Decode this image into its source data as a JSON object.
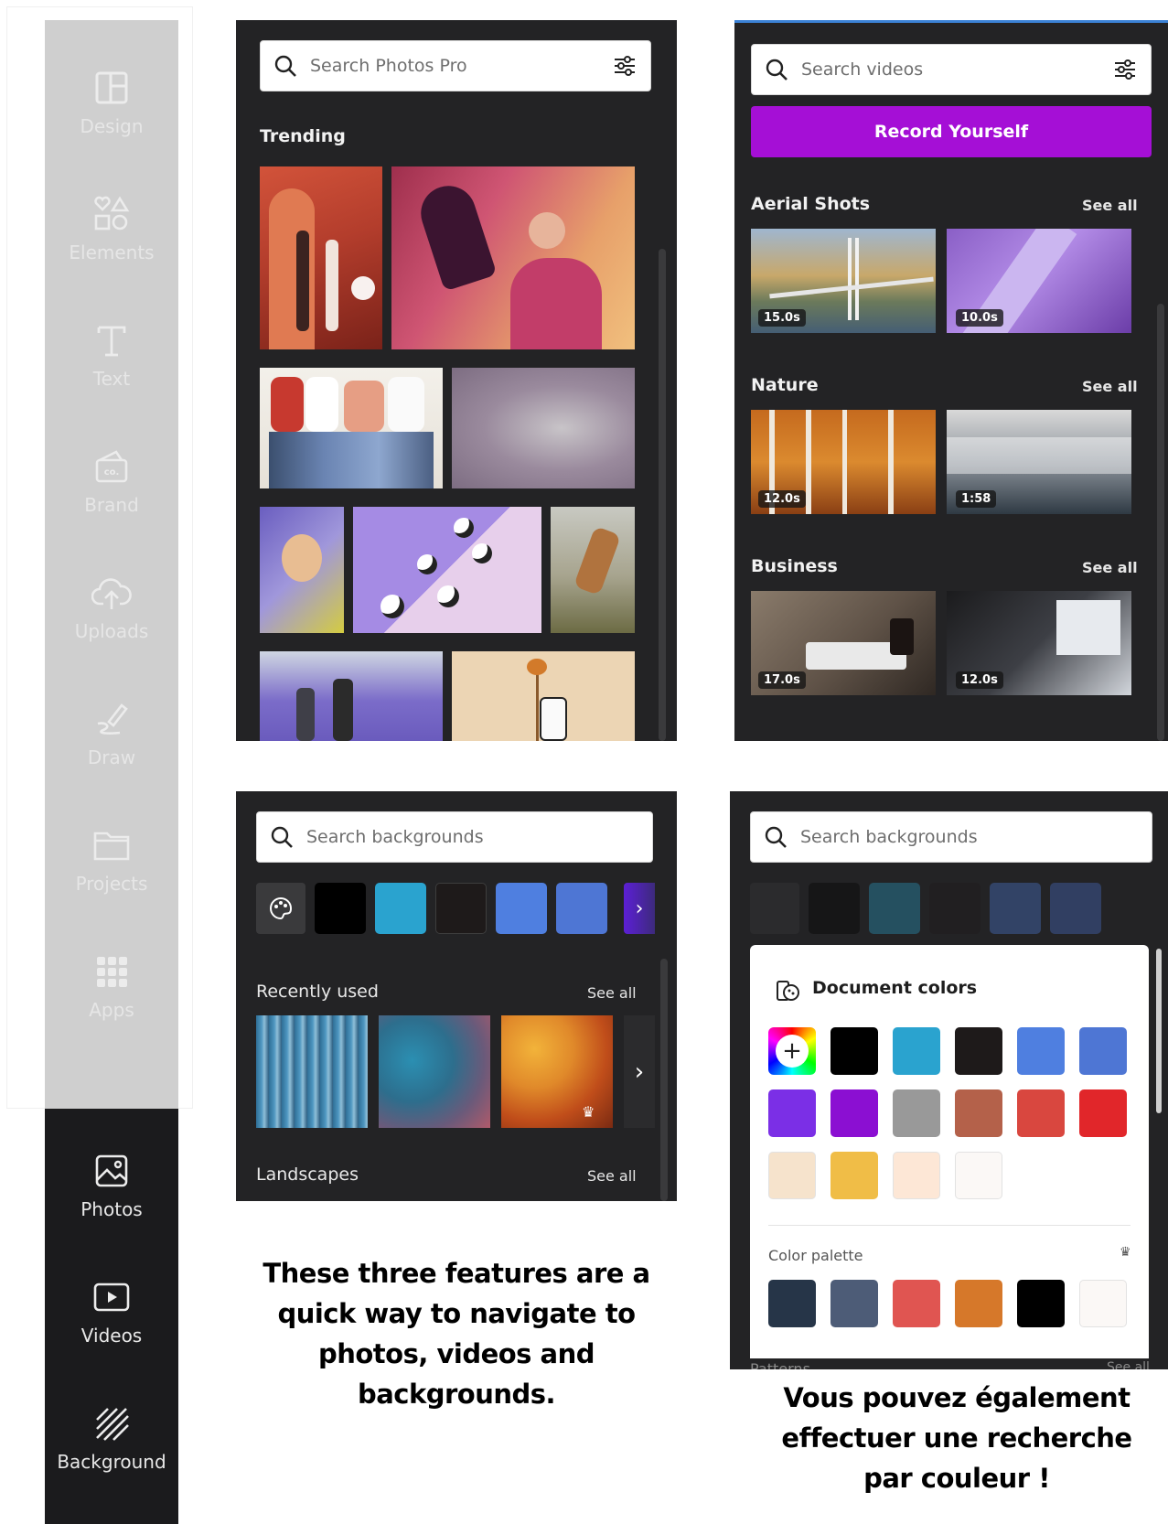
{
  "sidebar": {
    "items_light": [
      {
        "label": "Design",
        "icon": "layout-icon"
      },
      {
        "label": "Elements",
        "icon": "shapes-icon"
      },
      {
        "label": "Text",
        "icon": "text-icon"
      },
      {
        "label": "Brand",
        "icon": "brand-icon"
      },
      {
        "label": "Uploads",
        "icon": "cloud-upload-icon"
      },
      {
        "label": "Draw",
        "icon": "pen-icon"
      },
      {
        "label": "Projects",
        "icon": "folder-icon"
      },
      {
        "label": "Apps",
        "icon": "apps-grid-icon"
      }
    ],
    "items_dark": [
      {
        "label": "Photos",
        "icon": "image-icon"
      },
      {
        "label": "Videos",
        "icon": "video-icon"
      },
      {
        "label": "Background",
        "icon": "stripes-icon"
      }
    ]
  },
  "photos_panel": {
    "search_placeholder": "Search Photos Pro",
    "section": "Trending"
  },
  "videos_panel": {
    "search_placeholder": "Search videos",
    "record_button": "Record Yourself",
    "sections": [
      {
        "title": "Aerial Shots",
        "see_all": "See all",
        "durations": [
          "15.0s",
          "10.0s"
        ]
      },
      {
        "title": "Nature",
        "see_all": "See all",
        "durations": [
          "12.0s",
          "1:58"
        ]
      },
      {
        "title": "Business",
        "see_all": "See all",
        "durations": [
          "17.0s",
          "12.0s"
        ]
      }
    ]
  },
  "backgrounds_panel": {
    "search_placeholder": "Search backgrounds",
    "swatches": [
      "#000000",
      "#2aa3cf",
      "#1e1a1a",
      "#4f7fe0",
      "#4e76d4"
    ],
    "recently_used": "Recently used",
    "landscapes": "Landscapes",
    "see_all": "See all"
  },
  "colors_panel": {
    "search_placeholder": "Search backgrounds",
    "document_colors_title": "Document colors",
    "document_colors": [
      [
        "#000000",
        "#2aa3cf",
        "#1e1a1a",
        "#4f7fe0",
        "#4e76d4"
      ],
      [
        "#7b2fe6",
        "#8b0fd2",
        "#999999",
        "#b4614a",
        "#d9473f",
        "#e1262a"
      ],
      [
        "#f6e3cc",
        "#f0bd47",
        "#fde7d6",
        "#fbf8f6"
      ]
    ],
    "color_palette_title": "Color palette",
    "color_palette": [
      "#263548",
      "#4d5c77",
      "#e05551",
      "#d6782a",
      "#000000",
      "#fbf8f6"
    ],
    "behind_text_left": "Patterns",
    "behind_text_right": "See all"
  },
  "captions": {
    "english": "These three features are a quick way to navigate to photos, videos and backgrounds.",
    "french": "Vous pouvez également effectuer une recherche par couleur !"
  }
}
